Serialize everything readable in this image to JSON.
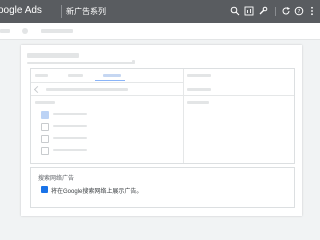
{
  "topbar": {
    "brand": "oogle Ads",
    "title": "新广告系列",
    "icons": [
      "search-icon",
      "chart-icon",
      "wrench-icon",
      "refresh-icon",
      "help-icon",
      "more-icon"
    ]
  },
  "network": {
    "title": "搜索网络广告",
    "checkbox_label": "将在Google搜索网络上展示广告。",
    "checked": true
  },
  "colors": {
    "topbar": "#595c60",
    "accent": "#1a73e8",
    "placeholder": "#e3e5e6"
  }
}
